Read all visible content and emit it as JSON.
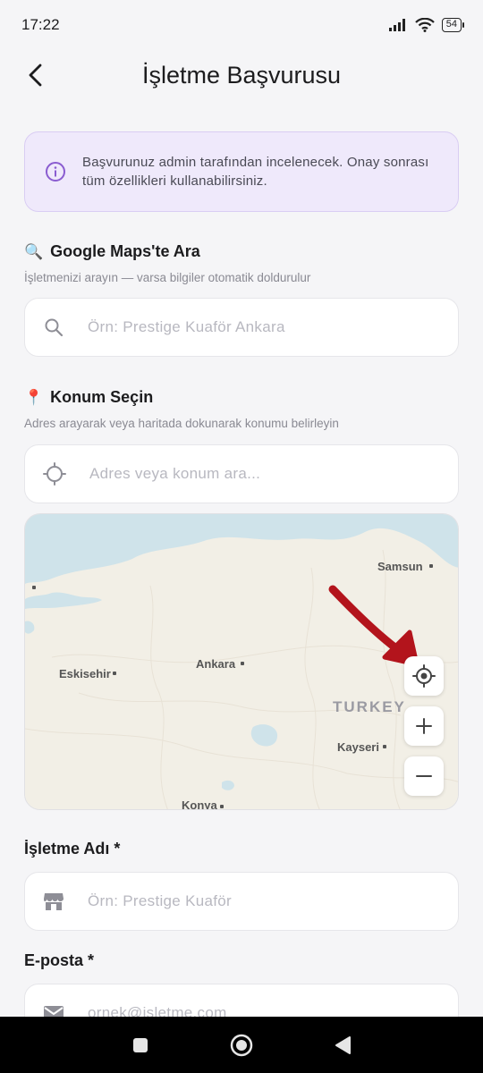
{
  "status_bar": {
    "time": "17:22",
    "battery": "54"
  },
  "header": {
    "title": "İşletme Başvurusu"
  },
  "info": {
    "text": "Başvurunuz admin tarafından incelenecek. Onay sonrası tüm özellikleri kullanabilirsiniz."
  },
  "maps_search": {
    "emoji": "🔍",
    "title": "Google Maps'te Ara",
    "subtitle": "İşletmenizi arayın — varsa bilgiler otomatik doldurulur",
    "placeholder": "Örn: Prestige Kuaför Ankara"
  },
  "location": {
    "emoji": "📍",
    "title": "Konum Seçin",
    "subtitle": "Adres arayarak veya haritada dokunarak konumu belirleyin",
    "placeholder": "Adres veya konum ara..."
  },
  "map": {
    "cities": [
      "Samsun",
      "Ankara",
      "Eskisehir",
      "Kayseri",
      "Konya"
    ],
    "country": "TURKEY",
    "colors": {
      "land": "#f2efe6",
      "water": "#cfe3ea",
      "arrow": "#b3141c"
    }
  },
  "business_name": {
    "label": "İşletme Adı *",
    "placeholder": "Örn: Prestige Kuaför"
  },
  "email": {
    "label": "E-posta *",
    "placeholder": "ornek@isletme.com"
  }
}
